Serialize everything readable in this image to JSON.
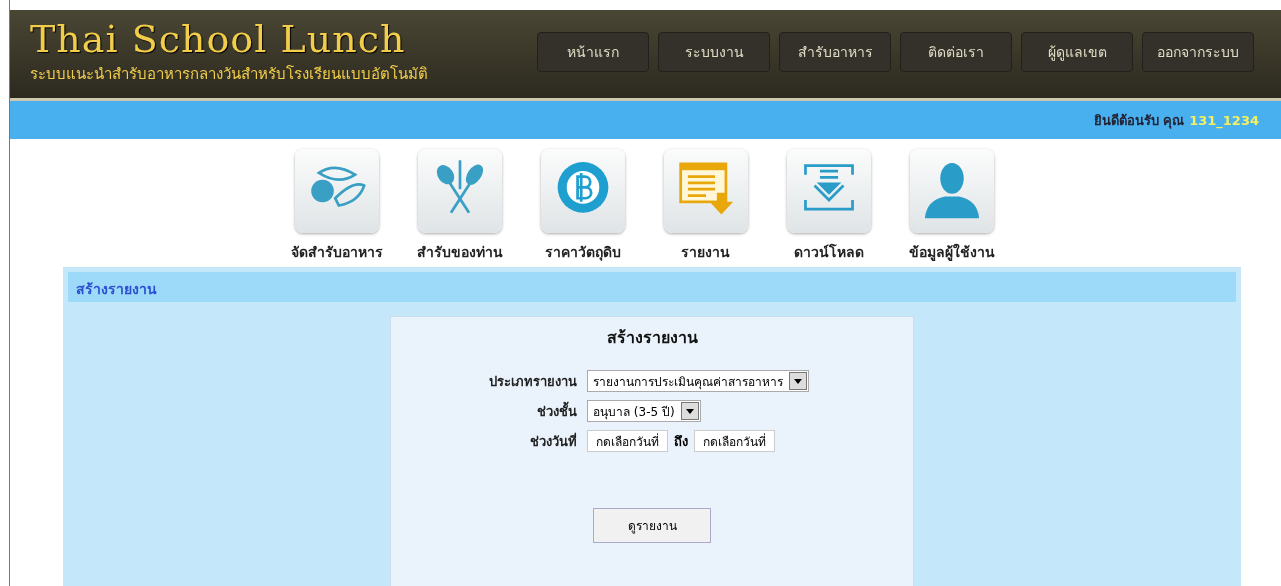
{
  "header": {
    "logo": "Thai School Lunch",
    "tagline": "ระบบแนะนำสำรับอาหารกลางวันสำหรับโรงเรียนแบบอัตโนมัติ"
  },
  "nav": [
    {
      "label": "หน้าแรก"
    },
    {
      "label": "ระบบงาน"
    },
    {
      "label": "สำรับอาหาร"
    },
    {
      "label": "ติดต่อเรา"
    },
    {
      "label": "ผู้ดูแลเขต"
    },
    {
      "label": "ออกจากระบบ"
    }
  ],
  "welcome": {
    "text": "ยินดีต้อนรับ คุณ",
    "user": "131_1234"
  },
  "shortcuts": [
    {
      "label": "จัดสำรับอาหาร"
    },
    {
      "label": "สำรับของท่าน"
    },
    {
      "label": "ราคาวัตถุดิบ"
    },
    {
      "label": "รายงาน"
    },
    {
      "label": "ดาวน์โหลด"
    },
    {
      "label": "ข้อมูลผู้ใช้งาน"
    }
  ],
  "panel": {
    "title": "สร้างรายงาน",
    "form_title": "สร้างรายงาน",
    "report_type": {
      "label": "ประเภทรายงาน",
      "value": "รายงานการประเมินคุณค่าสารอาหาร"
    },
    "grade": {
      "label": "ช่วงชั้น",
      "value": "อนุบาล (3-5 ปี)"
    },
    "dates": {
      "label": "ช่วงวันที่",
      "from": "กดเลือกวันที่",
      "separator": "ถึง",
      "to": "กดเลือกวันที่"
    },
    "button": "ดูรายงาน"
  }
}
